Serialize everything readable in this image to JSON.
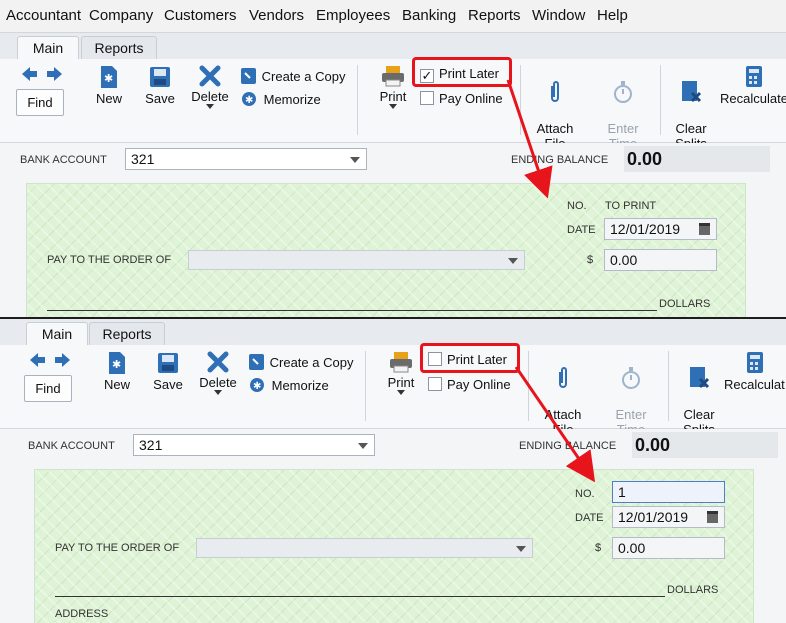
{
  "menu": [
    "Accountant",
    "Company",
    "Customers",
    "Vendors",
    "Employees",
    "Banking",
    "Reports",
    "Window",
    "Help"
  ],
  "panels": [
    {
      "tabs": {
        "main": "Main",
        "reports": "Reports"
      },
      "toolbar": {
        "find": "Find",
        "new": "New",
        "save": "Save",
        "delete": "Delete",
        "create_copy": "Create a Copy",
        "memorize": "Memorize",
        "print": "Print",
        "print_later": "Print Later",
        "print_later_checked": "✓",
        "pay_online": "Pay Online",
        "attach_file": "Attach\nFile",
        "enter_time": "Enter\nTime",
        "clear_splits": "Clear\nSplits",
        "recalculate": "Recalculate"
      },
      "form": {
        "bank_account_label": "BANK ACCOUNT",
        "bank_account_value": "321",
        "ending_balance_label": "ENDING BALANCE",
        "ending_balance_value": "0.00",
        "no_label": "NO.",
        "no_value": "TO PRINT",
        "date_label": "DATE",
        "date_value": "12/01/2019",
        "pay_to_label": "PAY TO THE ORDER OF",
        "dollar_sign": "$",
        "amount": "0.00",
        "dollars_label": "DOLLARS"
      }
    },
    {
      "tabs": {
        "main": "Main",
        "reports": "Reports"
      },
      "toolbar": {
        "find": "Find",
        "new": "New",
        "save": "Save",
        "delete": "Delete",
        "create_copy": "Create a Copy",
        "memorize": "Memorize",
        "print": "Print",
        "print_later": "Print Later",
        "print_later_checked": "",
        "pay_online": "Pay Online",
        "attach_file": "Attach\nFile",
        "enter_time": "Enter\nTime",
        "clear_splits": "Clear\nSplits",
        "recalculate": "Recalculat"
      },
      "form": {
        "bank_account_label": "BANK ACCOUNT",
        "bank_account_value": "321",
        "ending_balance_label": "ENDING BALANCE",
        "ending_balance_value": "0.00",
        "no_label": "NO.",
        "no_value": "1",
        "date_label": "DATE",
        "date_value": "12/01/2019",
        "pay_to_label": "PAY TO THE ORDER OF",
        "dollar_sign": "$",
        "amount": "0.00",
        "dollars_label": "DOLLARS",
        "address_label": "ADDRESS"
      }
    }
  ],
  "colors": {
    "highlight": "#e8141c",
    "check_bg": "#dff3d6",
    "accent_blue": "#2f6fb5"
  }
}
